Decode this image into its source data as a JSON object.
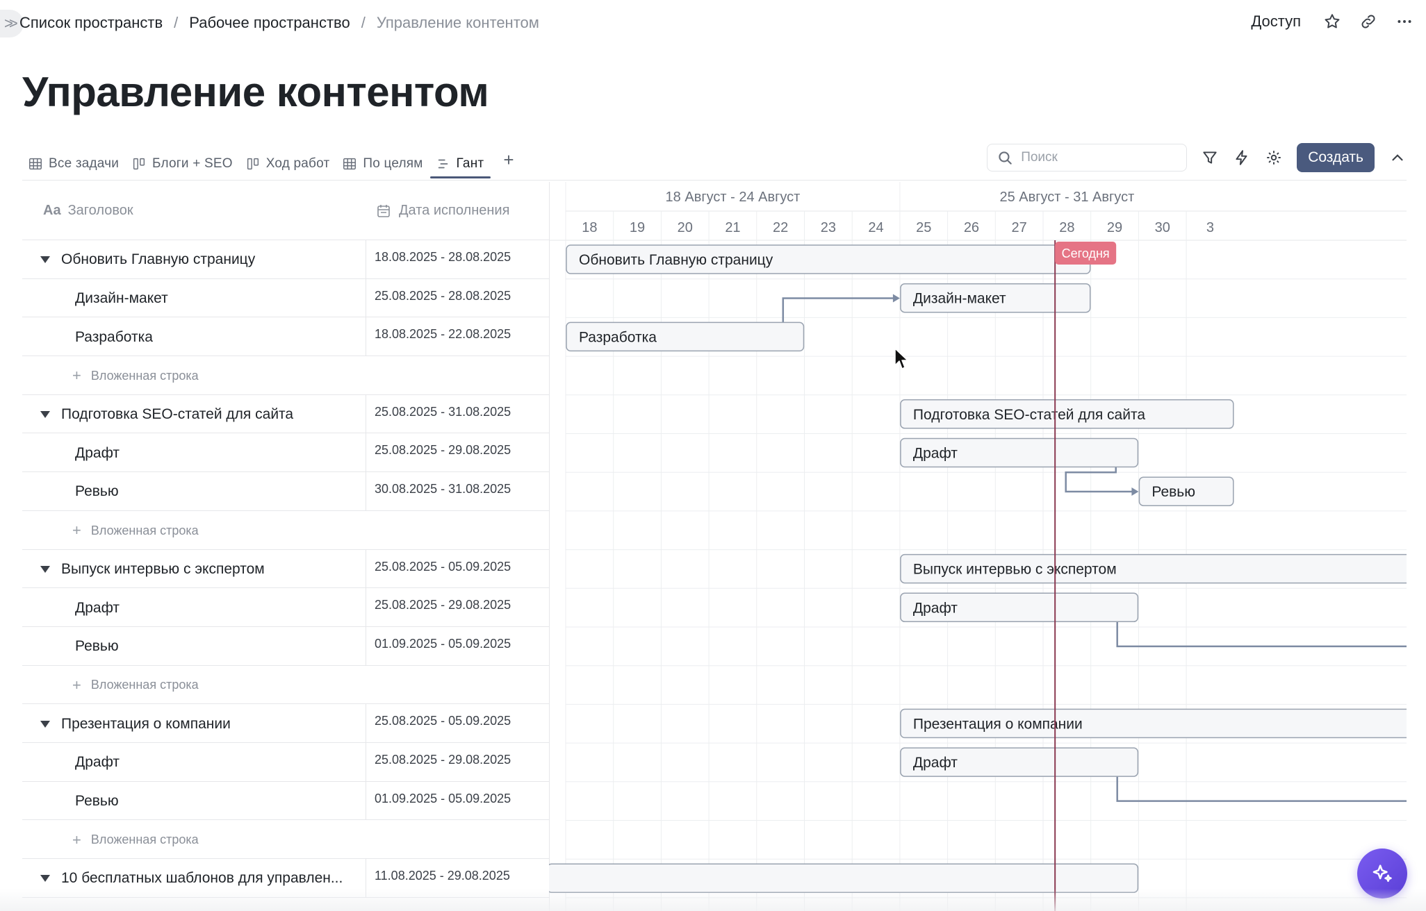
{
  "breadcrumbs": [
    "Список пространств",
    "Рабочее пространство",
    "Управление контентом"
  ],
  "top_actions": {
    "access_label": "Доступ"
  },
  "page_title": "Управление контентом",
  "tabs": [
    {
      "label": "Все задачи",
      "icon": "grid-icon"
    },
    {
      "label": "Блоги + SEO",
      "icon": "board-icon"
    },
    {
      "label": "Ход работ",
      "icon": "board-icon"
    },
    {
      "label": "По целям",
      "icon": "grid-icon"
    },
    {
      "label": "Гант",
      "icon": "gantt-icon",
      "active": true
    }
  ],
  "search": {
    "placeholder": "Поиск"
  },
  "create_label": "Создать",
  "table": {
    "col_title": "Заголовок",
    "col_date": "Дата исполнения",
    "add_label": "Вложенная строка",
    "rows": [
      {
        "type": "parent",
        "title": "Обновить Главную страницу",
        "date": "18.08.2025 - 28.08.2025"
      },
      {
        "type": "child",
        "title": "Дизайн-макет",
        "date": "25.08.2025 - 28.08.2025"
      },
      {
        "type": "child",
        "title": "Разработка",
        "date": "18.08.2025 - 22.08.2025"
      },
      {
        "type": "add"
      },
      {
        "type": "parent",
        "title": "Подготовка SEO-статей для сайта",
        "date": "25.08.2025 - 31.08.2025"
      },
      {
        "type": "child",
        "title": "Драфт",
        "date": "25.08.2025 - 29.08.2025"
      },
      {
        "type": "child",
        "title": "Ревью",
        "date": "30.08.2025 - 31.08.2025"
      },
      {
        "type": "add"
      },
      {
        "type": "parent",
        "title": "Выпуск интервью с экспертом",
        "date": "25.08.2025 - 05.09.2025"
      },
      {
        "type": "child",
        "title": "Драфт",
        "date": "25.08.2025 - 29.08.2025"
      },
      {
        "type": "child",
        "title": "Ревью",
        "date": "01.09.2025 - 05.09.2025"
      },
      {
        "type": "add"
      },
      {
        "type": "parent",
        "title": "Презентация о компании",
        "date": "25.08.2025 - 05.09.2025"
      },
      {
        "type": "child",
        "title": "Драфт",
        "date": "25.08.2025 - 29.08.2025"
      },
      {
        "type": "child",
        "title": "Ревью",
        "date": "01.09.2025 - 05.09.2025"
      },
      {
        "type": "add"
      },
      {
        "type": "parent",
        "title": "10 бесплатных шаблонов для управлен...",
        "date": "11.08.2025 - 29.08.2025"
      }
    ]
  },
  "gantt": {
    "weeks": [
      "18 Август - 24 Август",
      "25 Август - 31 Август"
    ],
    "days": [
      "18",
      "19",
      "20",
      "21",
      "22",
      "23",
      "24",
      "25",
      "26",
      "27",
      "28",
      "29",
      "30",
      "3"
    ],
    "today_label": "Сегодня",
    "today_day": 28.25,
    "first_day": 18,
    "bars": [
      {
        "row": 0,
        "start": 18,
        "end": 28,
        "label": "Обновить Главную страницу"
      },
      {
        "row": 1,
        "start": 25,
        "end": 28,
        "label": "Дизайн-макет"
      },
      {
        "row": 2,
        "start": 18,
        "end": 22,
        "label": "Разработка"
      },
      {
        "row": 4,
        "start": 25,
        "end": 31,
        "label": "Подготовка SEO-статей для сайта"
      },
      {
        "row": 5,
        "start": 25,
        "end": 29,
        "label": "Драфт"
      },
      {
        "row": 6,
        "start": 30,
        "end": 31,
        "label": "Ревью"
      },
      {
        "row": 8,
        "start": 25,
        "end": 36,
        "label": "Выпуск интервью с экспертом"
      },
      {
        "row": 9,
        "start": 25,
        "end": 29,
        "label": "Драфт"
      },
      {
        "row": 12,
        "start": 25,
        "end": 36,
        "label": "Презентация о компании"
      },
      {
        "row": 13,
        "start": 25,
        "end": 29,
        "label": "Драфт"
      },
      {
        "row": 16,
        "start": 11,
        "end": 29,
        "label": ""
      }
    ],
    "links": [
      {
        "from_row": 2,
        "from_day": 22,
        "to_row": 1,
        "to_day": 25,
        "arrow": true
      },
      {
        "from_row": 5,
        "from_day": 29,
        "to_row": 6,
        "to_day": 30,
        "arrow": true
      },
      {
        "from_row": 9,
        "from_day": 29,
        "to_row": 10,
        "to_day": 36,
        "arrow": false
      },
      {
        "from_row": 13,
        "from_day": 29,
        "to_row": 14,
        "to_day": 36,
        "arrow": false
      }
    ]
  },
  "colors": {
    "accent": "#4a5a7e",
    "today_line": "#8b3a52",
    "today_badge": "#e57485",
    "bar_fill": "#f6f7f9",
    "bar_border": "#9aa3b0",
    "link": "#7d8ba3",
    "fab": "#6a4de6"
  }
}
